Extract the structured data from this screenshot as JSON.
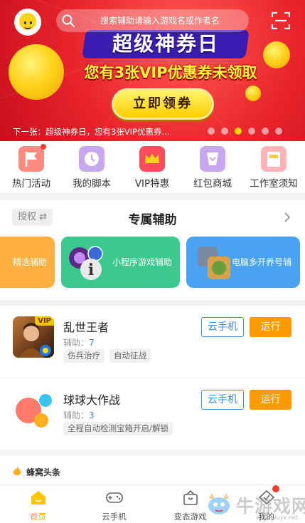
{
  "header": {
    "search_placeholder": "搜索辅助请输入游戏名或作者名"
  },
  "banner": {
    "headline": "超级神券日",
    "subhead": "您有3张VIP优惠券未领取",
    "claim_button": "立即领券",
    "ticker": "下一张：超级神券日，您有3张VIP优惠券...",
    "page_count": 6,
    "active_index": 2,
    "colors": {
      "background": "#e8232b",
      "headline_bg": "#3a1db0",
      "button": "#ffcc00"
    }
  },
  "quick_menu": [
    {
      "label": "热门活动",
      "icon": "flag-icon",
      "color": "#ff8a80",
      "badge": true
    },
    {
      "label": "我的脚本",
      "icon": "clock-icon",
      "color": "#c9a7f0",
      "badge": false
    },
    {
      "label": "VIP特惠",
      "icon": "crown-icon",
      "color": "#ff4b5c",
      "badge": false
    },
    {
      "label": "红包商城",
      "icon": "cup-icon",
      "color": "#c9a7f0",
      "badge": false
    },
    {
      "label": "工作室须知",
      "icon": "book-icon",
      "color": "#ffb3b8",
      "badge": false
    }
  ],
  "exclusive": {
    "auth_label": "授权",
    "title": "专属辅助",
    "cards": [
      {
        "label": "精选辅助",
        "color": "#ffb040"
      },
      {
        "label": "小程序游戏辅助",
        "color": "#3cc98d"
      },
      {
        "label": "电脑多开养号辅",
        "color": "#4aa3f0"
      }
    ]
  },
  "games": [
    {
      "name": "乱世王者",
      "helper_label": "辅助：",
      "helper_count": "7",
      "vip": "VIP",
      "tags": [
        "伤兵治疗",
        "自动征战"
      ],
      "cloud_button": "云手机",
      "run_button": "运行"
    },
    {
      "name": "球球大作战",
      "helper_label": "辅助：",
      "helper_count": "3",
      "tags": [
        "全程自动检测宝箱开启/解锁"
      ],
      "cloud_button": "云手机",
      "run_button": "运行"
    }
  ],
  "headlines": {
    "title": "蜂窝头条"
  },
  "tabbar": [
    {
      "label": "首页",
      "icon": "home-icon",
      "active": true
    },
    {
      "label": "云手机",
      "icon": "gamepad-icon",
      "active": false
    },
    {
      "label": "变态游戏",
      "icon": "gift-icon",
      "active": false
    },
    {
      "label": "我的",
      "icon": "profile-icon",
      "active": false,
      "badge": true
    }
  ],
  "watermark": {
    "text": "牛游戏网",
    "url": "www.niuyx.net"
  }
}
